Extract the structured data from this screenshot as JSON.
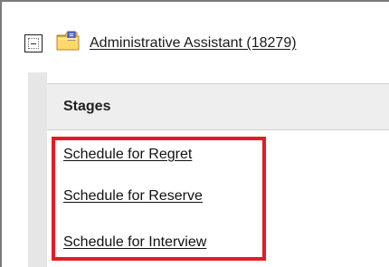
{
  "job": {
    "title": "Administrative Assistant (18279)"
  },
  "stages": {
    "header": "Stages",
    "items": [
      {
        "label": "Schedule for Regret"
      },
      {
        "label": "Schedule for Reserve"
      },
      {
        "label": "Schedule for Interview"
      }
    ]
  },
  "colors": {
    "highlight": "#e51b24",
    "header_background": "#eeeeee",
    "gutter_background": "#e6e6e6"
  },
  "icons": {
    "toggle": "collapse-toggle-icon",
    "job": "folder-icon"
  }
}
